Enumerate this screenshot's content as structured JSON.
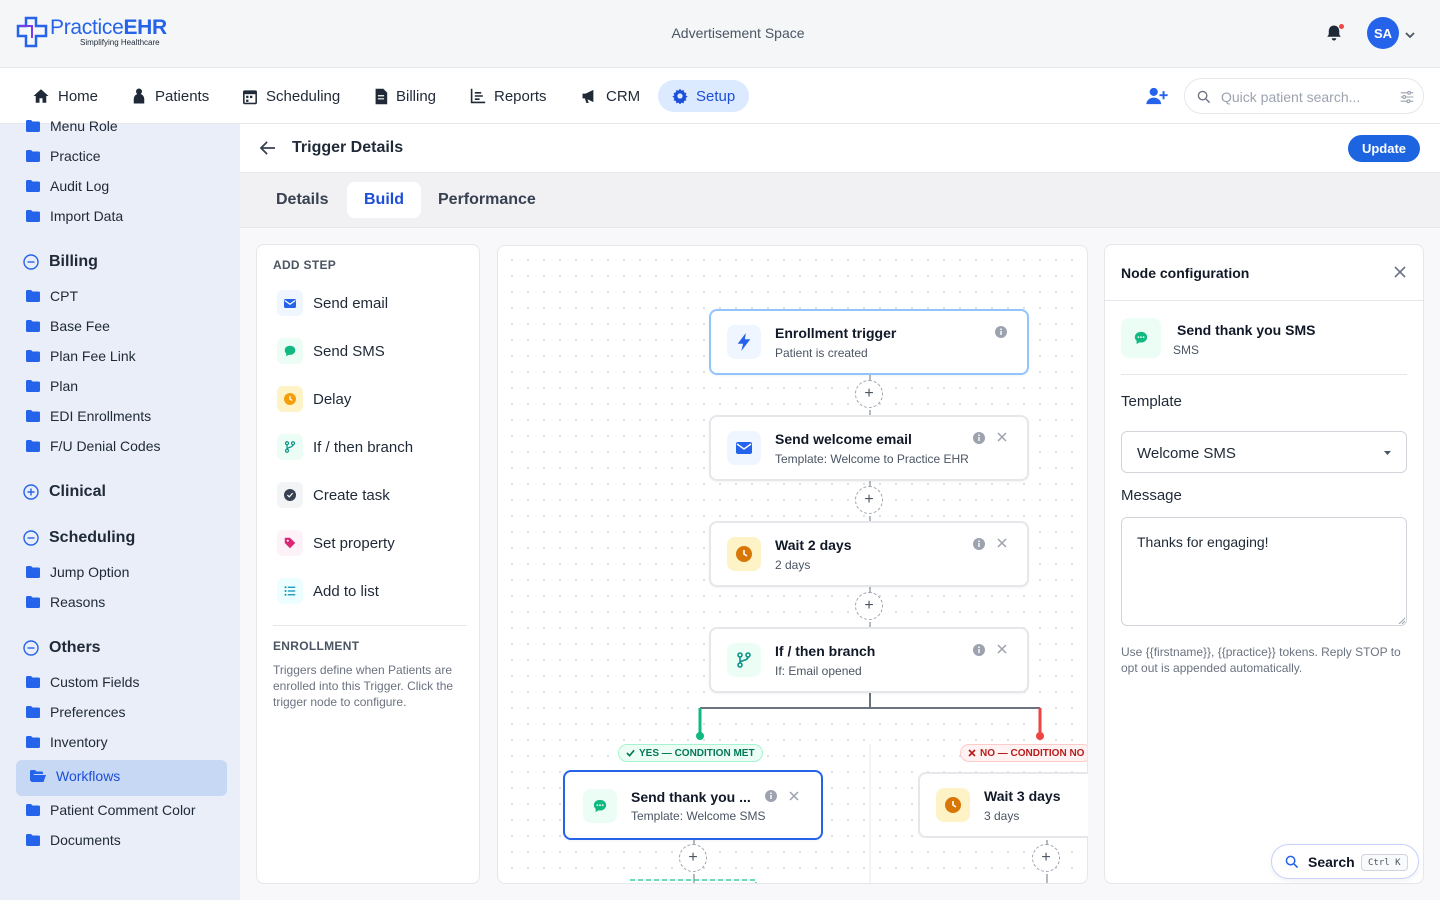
{
  "header": {
    "logo_name_light": "Practice",
    "logo_name_bold": "EHR",
    "logo_tagline": "Simplifying Healthcare",
    "ad_space": "Advertisement Space",
    "avatar_initials": "SA"
  },
  "nav": {
    "items": [
      {
        "label": "Home",
        "icon": "home-icon"
      },
      {
        "label": "Patients",
        "icon": "patient-icon"
      },
      {
        "label": "Scheduling",
        "icon": "calendar-icon"
      },
      {
        "label": "Billing",
        "icon": "invoice-icon"
      },
      {
        "label": "Reports",
        "icon": "report-icon"
      },
      {
        "label": "CRM",
        "icon": "megaphone-icon"
      },
      {
        "label": "Setup",
        "icon": "gear-icon",
        "active": true
      }
    ],
    "search_placeholder": "Quick patient search..."
  },
  "sidebar": {
    "items": [
      "Menu Role",
      "Practice",
      "Audit Log",
      "Import Data",
      "CPT",
      "Base Fee",
      "Plan Fee Link",
      "Plan",
      "EDI Enrollments",
      "F/U Denial Codes",
      "Jump Option",
      "Reasons",
      "Custom Fields",
      "Preferences",
      "Inventory",
      "Workflows",
      "Patient Comment Color",
      "Documents"
    ],
    "sections": [
      {
        "label": "Billing",
        "state": "expanded"
      },
      {
        "label": "Clinical",
        "state": "collapsed"
      },
      {
        "label": "Scheduling",
        "state": "expanded"
      },
      {
        "label": "Others",
        "state": "expanded"
      }
    ],
    "active_item": "Workflows"
  },
  "page": {
    "title": "Trigger Details",
    "update_label": "Update",
    "tabs": [
      "Details",
      "Build",
      "Performance"
    ],
    "active_tab": "Build"
  },
  "add_step": {
    "heading": "ADD STEP",
    "steps": [
      "Send email",
      "Send SMS",
      "Delay",
      "If / then branch",
      "Create task",
      "Set property",
      "Add to list"
    ],
    "enrollment_heading": "ENROLLMENT",
    "enrollment_text": "Triggers define when Patients are enrolled into this Trigger. Click the trigger node to configure."
  },
  "flow": {
    "nodes": [
      {
        "title": "Enrollment trigger",
        "subtitle": "Patient is created"
      },
      {
        "title": "Send welcome email",
        "subtitle": "Template: Welcome to Practice EHR"
      },
      {
        "title": "Wait 2 days",
        "subtitle": "2 days"
      },
      {
        "title": "If / then branch",
        "subtitle": "If: Email opened"
      },
      {
        "title": "Send thank you ...",
        "subtitle": "Template: Welcome SMS"
      },
      {
        "title": "Wait 3 days",
        "subtitle": "3 days"
      }
    ],
    "yes_badge": "YES — CONDITION MET",
    "no_badge": "NO — CONDITION NO",
    "add_symbol": "+"
  },
  "config": {
    "title": "Node configuration",
    "node_name": "Send thank you SMS",
    "node_type": "SMS",
    "template_label": "Template",
    "template_value": "Welcome SMS",
    "message_label": "Message",
    "message_value": "Thanks for engaging!",
    "help_text": "Use {{firstname}}, {{practice}} tokens. Reply STOP to opt out is appended automatically."
  },
  "search_pill": {
    "label": "Search",
    "shortcut": "Ctrl K"
  },
  "colors": {
    "primary": "#2563eb",
    "yes": "#10b981",
    "no": "#ef4444",
    "sidebar_bg": "#e9eef8"
  }
}
